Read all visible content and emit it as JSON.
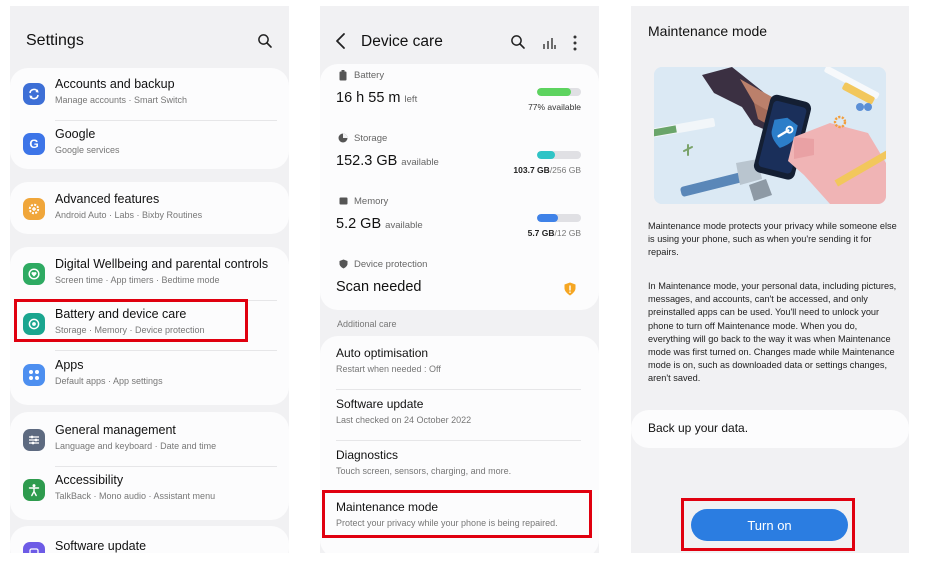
{
  "settings": {
    "title": "Settings",
    "items": [
      {
        "label": "Accounts and backup",
        "sub": "Manage accounts  ·  Smart Switch",
        "icon": "sync-icon",
        "color": "#3d6fd6"
      },
      {
        "label": "Google",
        "sub": "Google services",
        "icon": "google-icon",
        "color": "#3d75e8"
      },
      {
        "label": "Advanced features",
        "sub": "Android Auto  ·  Labs  ·  Bixby Routines",
        "icon": "gear-plus-icon",
        "color": "#f0a63a"
      },
      {
        "label": "Digital Wellbeing and parental controls",
        "sub": "Screen time  ·  App timers  ·  Bedtime mode",
        "icon": "wellbeing-icon",
        "color": "#2eaa62"
      },
      {
        "label": "Battery and device care",
        "sub": "Storage  ·  Memory  ·  Device protection",
        "icon": "device-care-icon",
        "color": "#1aa58f"
      },
      {
        "label": "Apps",
        "sub": "Default apps  ·  App settings",
        "icon": "apps-grid-icon",
        "color": "#4d8ff0"
      },
      {
        "label": "General management",
        "sub": "Language and keyboard  ·  Date and time",
        "icon": "sliders-icon",
        "color": "#5d6a80"
      },
      {
        "label": "Accessibility",
        "sub": "TalkBack  ·  Mono audio  ·  Assistant menu",
        "icon": "accessibility-icon",
        "color": "#2e9b4e"
      },
      {
        "label": "Software update",
        "sub": "",
        "icon": "software-update-icon",
        "color": "#6d5be6"
      }
    ]
  },
  "device_care": {
    "title": "Device care",
    "battery": {
      "label": "Battery",
      "value": "16 h 55 m",
      "unit": "left",
      "right": "77% available",
      "level": 0.77,
      "color": "#5dd35f"
    },
    "storage": {
      "label": "Storage",
      "value": "152.3 GB",
      "unit": "available",
      "right_bold": "103.7 GB",
      "right_thin": "/256 GB",
      "level": 0.4,
      "color": "#2fc4c6"
    },
    "memory": {
      "label": "Memory",
      "value": "5.2 GB",
      "unit": "available",
      "right_bold": "5.7 GB",
      "right_thin": "/12 GB",
      "level": 0.48,
      "color": "#3f82e8"
    },
    "protection": {
      "label": "Device protection",
      "value": "Scan needed"
    },
    "additional_care": "Additional care",
    "care_items": [
      {
        "label": "Auto optimisation",
        "sub": "Restart when needed : Off"
      },
      {
        "label": "Software update",
        "sub": "Last checked on 24 October 2022"
      },
      {
        "label": "Diagnostics",
        "sub": "Touch screen, sensors, charging, and more."
      },
      {
        "label": "Maintenance mode",
        "sub": "Protect your privacy while your phone is being repaired."
      }
    ]
  },
  "maintenance": {
    "title": "Maintenance mode",
    "desc1": "Maintenance mode protects your privacy while someone else is using your phone, such as when you're sending it for repairs.",
    "desc2": "In Maintenance mode, your personal data, including pictures, messages, and accounts, can't be accessed, and only preinstalled apps can be used. You'll need to unlock your phone to turn off Maintenance mode. When you do, everything will go back to the way it was when Maintenance mode was first turned on. Changes made while Maintenance mode is on, such as downloaded data or settings changes, aren't saved.",
    "backup": "Back up your data.",
    "button": "Turn on"
  }
}
